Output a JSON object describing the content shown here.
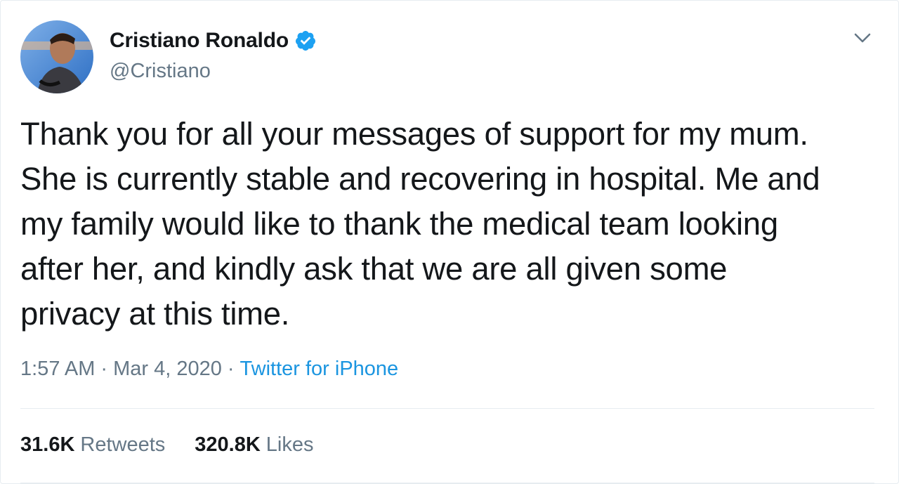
{
  "tweet": {
    "author_name": "Cristiano Ronaldo",
    "author_handle": "@Cristiano",
    "verified_icon": "verified-badge-icon",
    "menu_icon": "chevron-down-icon",
    "text_lines": [
      "Thank you for all your messages of support for my mum.",
      "She is currently stable and recovering in hospital. Me and",
      "my family would like to thank the medical team looking",
      "after her, and kindly ask that we are all given some",
      "privacy at this time."
    ],
    "time": "1:57 AM",
    "date": "Mar 4, 2020",
    "separator": "·",
    "source": "Twitter for iPhone",
    "retweets_count": "31.6K",
    "retweets_label": "Retweets",
    "likes_count": "320.8K",
    "likes_label": "Likes"
  },
  "colors": {
    "text": "#14171a",
    "secondary": "#657786",
    "link": "#1b95e0",
    "verified": "#1da1f2",
    "divider": "#e6ecf0"
  }
}
